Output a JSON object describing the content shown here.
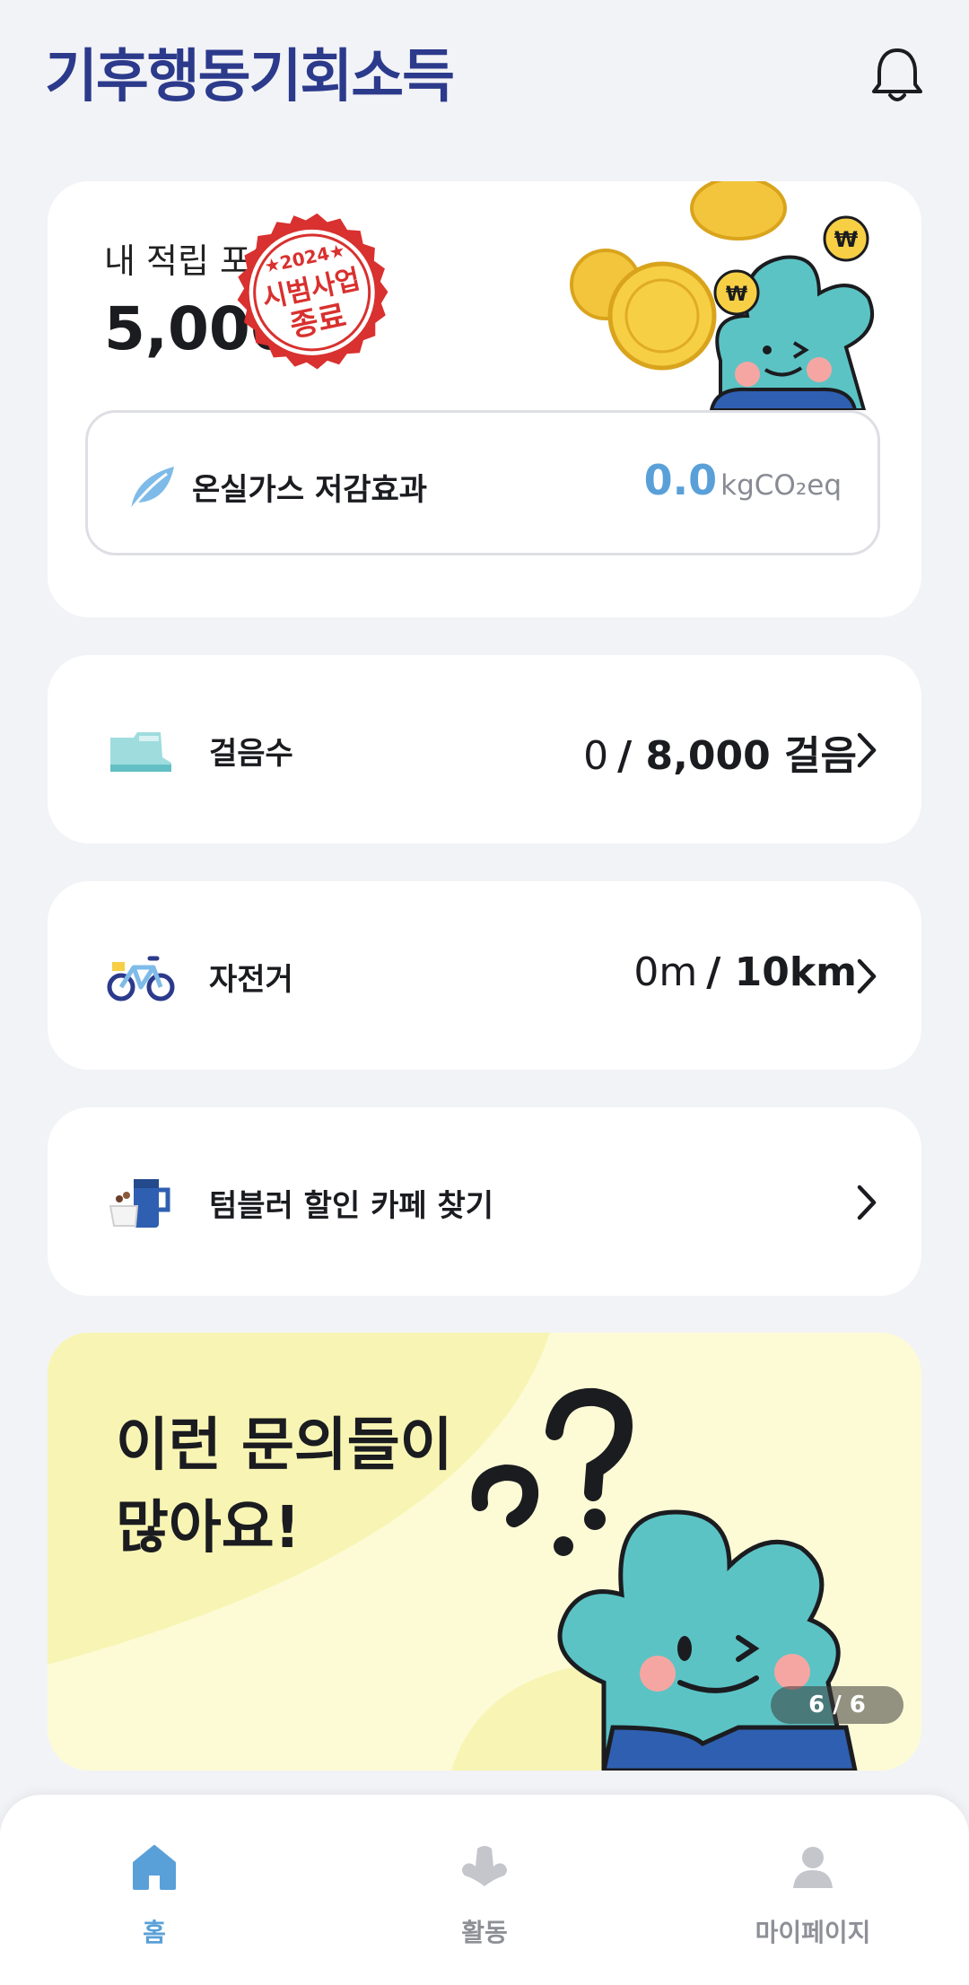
{
  "app": {
    "logo_text": "기후행동기회소득"
  },
  "points": {
    "label": "내 적립 포인트",
    "value": "5,000",
    "stamp_year": "2024",
    "stamp_line1": "시범사업",
    "stamp_line2": "종료"
  },
  "ghg": {
    "label": "온실가스 저감효과",
    "value": "0.0",
    "unit": "kgCO₂eq"
  },
  "steps": {
    "label": "걸음수",
    "current": "0",
    "goal": "/ 8,000 걸음"
  },
  "bike": {
    "label": "자전거",
    "current": "0m",
    "goal": "/ 10km"
  },
  "tumbler": {
    "label": "텀블러 할인 카페 찾기"
  },
  "banner": {
    "line1": "이런 문의들이",
    "line2": "많아요!",
    "counter": "6 / 6"
  },
  "tabs": [
    {
      "label": "홈",
      "icon": "home-icon",
      "active": true
    },
    {
      "label": "활동",
      "icon": "activity-icon",
      "active": false
    },
    {
      "label": "마이페이지",
      "icon": "person-icon",
      "active": false
    }
  ],
  "colors": {
    "accent": "#5aa0d8",
    "logo": "#2c3a8c",
    "stamp": "#d8312f",
    "mascot": "#5cc3c4"
  }
}
